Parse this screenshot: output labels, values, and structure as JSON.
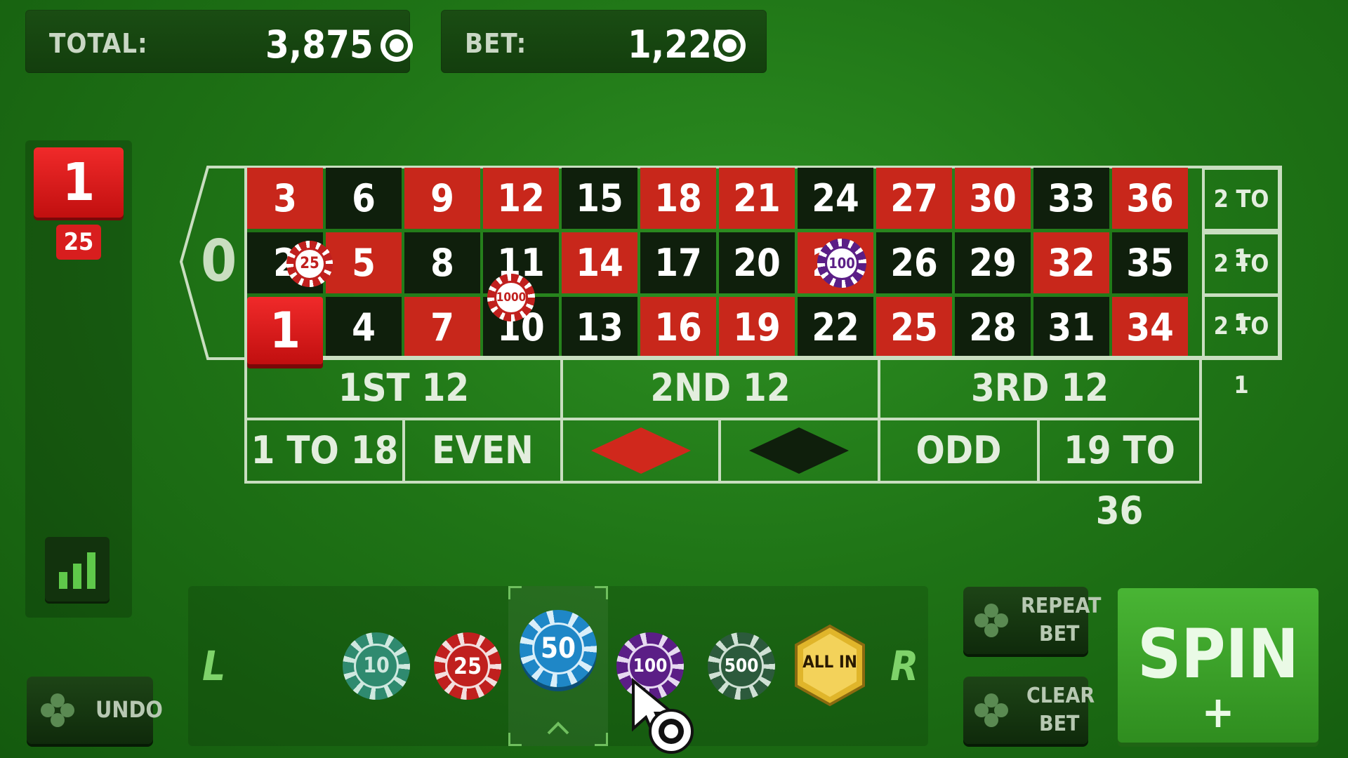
{
  "header": {
    "total_label": "TOTAL:",
    "total_value": "3,875",
    "bet_label": "BET:",
    "bet_value": "1,225"
  },
  "history": {
    "last_result": "1",
    "last_bet": "25"
  },
  "table": {
    "zero": "0",
    "rows": [
      [
        {
          "n": "3",
          "c": "red"
        },
        {
          "n": "6",
          "c": "black"
        },
        {
          "n": "9",
          "c": "red"
        },
        {
          "n": "12",
          "c": "red"
        },
        {
          "n": "15",
          "c": "black"
        },
        {
          "n": "18",
          "c": "red"
        },
        {
          "n": "21",
          "c": "red"
        },
        {
          "n": "24",
          "c": "black"
        },
        {
          "n": "27",
          "c": "red"
        },
        {
          "n": "30",
          "c": "red"
        },
        {
          "n": "33",
          "c": "black"
        },
        {
          "n": "36",
          "c": "red"
        }
      ],
      [
        {
          "n": "2",
          "c": "black"
        },
        {
          "n": "5",
          "c": "red"
        },
        {
          "n": "8",
          "c": "black"
        },
        {
          "n": "11",
          "c": "black"
        },
        {
          "n": "14",
          "c": "red"
        },
        {
          "n": "17",
          "c": "black"
        },
        {
          "n": "20",
          "c": "black"
        },
        {
          "n": "23",
          "c": "red"
        },
        {
          "n": "26",
          "c": "black"
        },
        {
          "n": "29",
          "c": "black"
        },
        {
          "n": "32",
          "c": "red"
        },
        {
          "n": "35",
          "c": "black"
        }
      ],
      [
        {
          "n": "1",
          "c": "red"
        },
        {
          "n": "4",
          "c": "black"
        },
        {
          "n": "7",
          "c": "red"
        },
        {
          "n": "10",
          "c": "black"
        },
        {
          "n": "13",
          "c": "black"
        },
        {
          "n": "16",
          "c": "red"
        },
        {
          "n": "19",
          "c": "red"
        },
        {
          "n": "22",
          "c": "black"
        },
        {
          "n": "25",
          "c": "red"
        },
        {
          "n": "28",
          "c": "black"
        },
        {
          "n": "31",
          "c": "black"
        },
        {
          "n": "34",
          "c": "red"
        }
      ]
    ],
    "columns": [
      "2 TO 1",
      "2 TO 1",
      "2 TO 1"
    ],
    "dozens": [
      "1ST 12",
      "2ND 12",
      "3RD 12"
    ],
    "outside": [
      "1 TO 18",
      "EVEN",
      "ODD",
      "19 TO 36"
    ],
    "highlighted_number": "1",
    "placed_chips": [
      "25",
      "1000",
      "100"
    ]
  },
  "chip_rack": {
    "left_arrow": "L",
    "right_arrow": "R",
    "chips": [
      "10",
      "25",
      "50",
      "100",
      "500",
      "ALL IN"
    ],
    "selected_chip": "50"
  },
  "buttons": {
    "undo": "UNDO",
    "repeat_bet": [
      "REPEAT",
      "BET"
    ],
    "clear_bet": [
      "CLEAR",
      "BET"
    ],
    "spin": "SPIN",
    "spin_plus": "+"
  },
  "colors": {
    "felt": "#1f7416",
    "red": "#c8271b",
    "black": "#0f1f0c",
    "spin_green": "#49b534"
  }
}
